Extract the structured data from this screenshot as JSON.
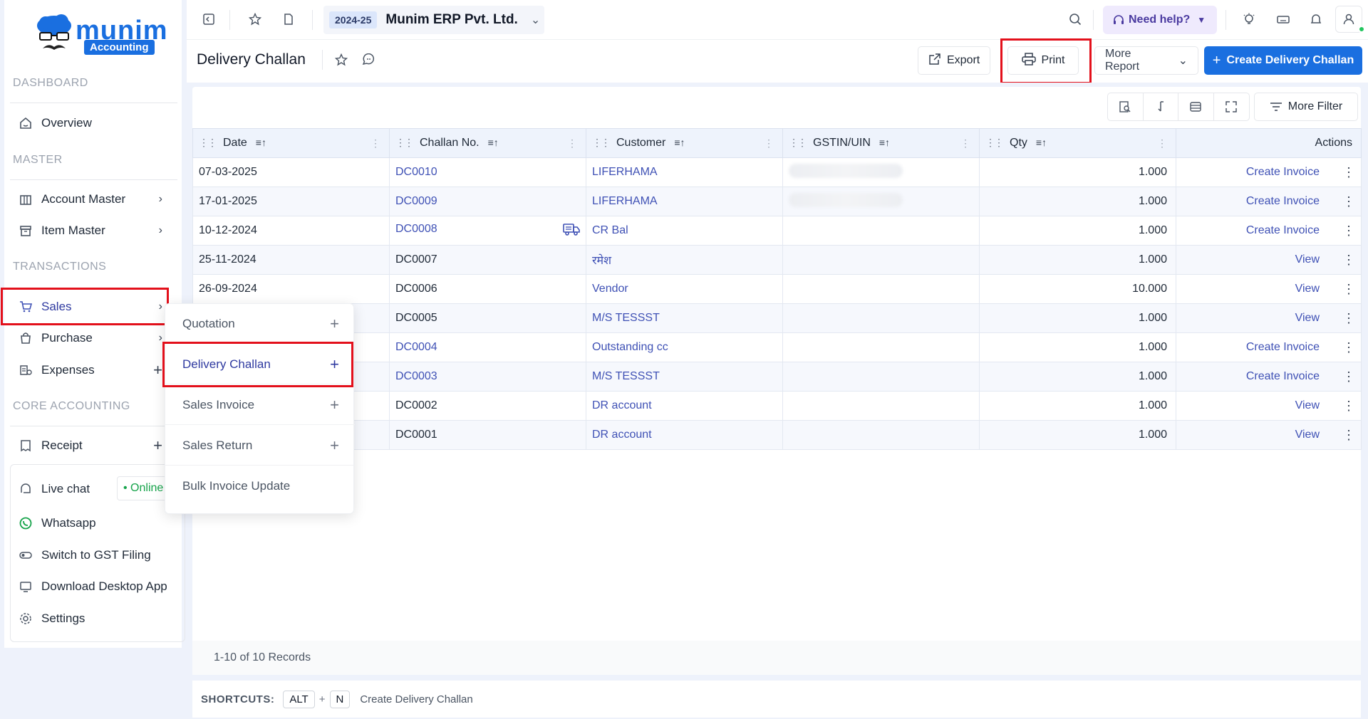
{
  "logo": {
    "word": "munim",
    "badge": "Accounting"
  },
  "sidebar": {
    "sections": {
      "dashboard": "DASHBOARD",
      "master": "MASTER",
      "transactions": "TRANSACTIONS",
      "core_accounting": "CORE ACCOUNTING"
    },
    "items": {
      "overview": "Overview",
      "account_master": "Account Master",
      "item_master": "Item Master",
      "sales": "Sales",
      "purchase": "Purchase",
      "expenses": "Expenses",
      "receipt": "Receipt",
      "live_chat": "Live chat",
      "online": "• Online",
      "whatsapp": "Whatsapp",
      "gst_filing": "Switch to GST Filing",
      "desktop_app": "Download Desktop App",
      "settings": "Settings"
    }
  },
  "flyout": {
    "items": [
      "Quotation",
      "Delivery Challan",
      "Sales Invoice",
      "Sales Return",
      "Bulk Invoice Update"
    ]
  },
  "topbar": {
    "year": "2024-25",
    "company": "Munim ERP Pvt. Ltd.",
    "help": "Need help?"
  },
  "header": {
    "title": "Delivery Challan",
    "export": "Export",
    "print": "Print",
    "more_report": "More Report",
    "create": "Create Delivery Challan"
  },
  "toolbar": {
    "more_filter": "More Filter"
  },
  "table": {
    "columns": [
      "Date",
      "Challan No.",
      "Customer",
      "GSTIN/UIN",
      "Qty",
      "Actions"
    ],
    "rows": [
      {
        "date": "07-03-2025",
        "challan": "DC0010",
        "challan_link": true,
        "customer": "LIFERHAMA",
        "gstin_blurred": true,
        "qty": "1.000",
        "action": "Create Invoice"
      },
      {
        "date": "17-01-2025",
        "challan": "DC0009",
        "challan_link": true,
        "customer": "LIFERHAMA",
        "gstin_blurred": true,
        "qty": "1.000",
        "action": "Create Invoice"
      },
      {
        "date": "10-12-2024",
        "challan": "DC0008",
        "challan_link": true,
        "customer": "CR Bal",
        "gstin_blurred": false,
        "qty": "1.000",
        "action": "Create Invoice",
        "truck": true
      },
      {
        "date": "25-11-2024",
        "challan": "DC0007",
        "challan_link": false,
        "customer": "रमेश",
        "gstin_blurred": false,
        "qty": "1.000",
        "action": "View"
      },
      {
        "date": "26-09-2024",
        "challan": "DC0006",
        "challan_link": false,
        "customer": "Vendor",
        "gstin_blurred": false,
        "qty": "10.000",
        "action": "View"
      },
      {
        "date": "",
        "challan": "DC0005",
        "challan_link": false,
        "customer": "M/S TESSST",
        "gstin_blurred": false,
        "qty": "1.000",
        "action": "View"
      },
      {
        "date": "",
        "challan": "DC0004",
        "challan_link": true,
        "customer": "Outstanding cc",
        "gstin_blurred": false,
        "qty": "1.000",
        "action": "Create Invoice"
      },
      {
        "date": "",
        "challan": "DC0003",
        "challan_link": true,
        "customer": "M/S TESSST",
        "gstin_blurred": false,
        "qty": "1.000",
        "action": "Create Invoice"
      },
      {
        "date": "",
        "challan": "DC0002",
        "challan_link": false,
        "customer": "DR account",
        "gstin_blurred": false,
        "qty": "1.000",
        "action": "View"
      },
      {
        "date": "",
        "challan": "DC0001",
        "challan_link": false,
        "customer": "DR account",
        "gstin_blurred": false,
        "qty": "1.000",
        "action": "View"
      }
    ]
  },
  "records": "1-10 of 10 Records",
  "shortcuts": {
    "label": "SHORTCUTS:",
    "key1": "ALT",
    "plus": "+",
    "key2": "N",
    "desc": "Create Delivery Challan"
  },
  "colors": {
    "accent": "#1a6fe0",
    "link": "#3f51b5",
    "highlight": "#e3101b"
  }
}
